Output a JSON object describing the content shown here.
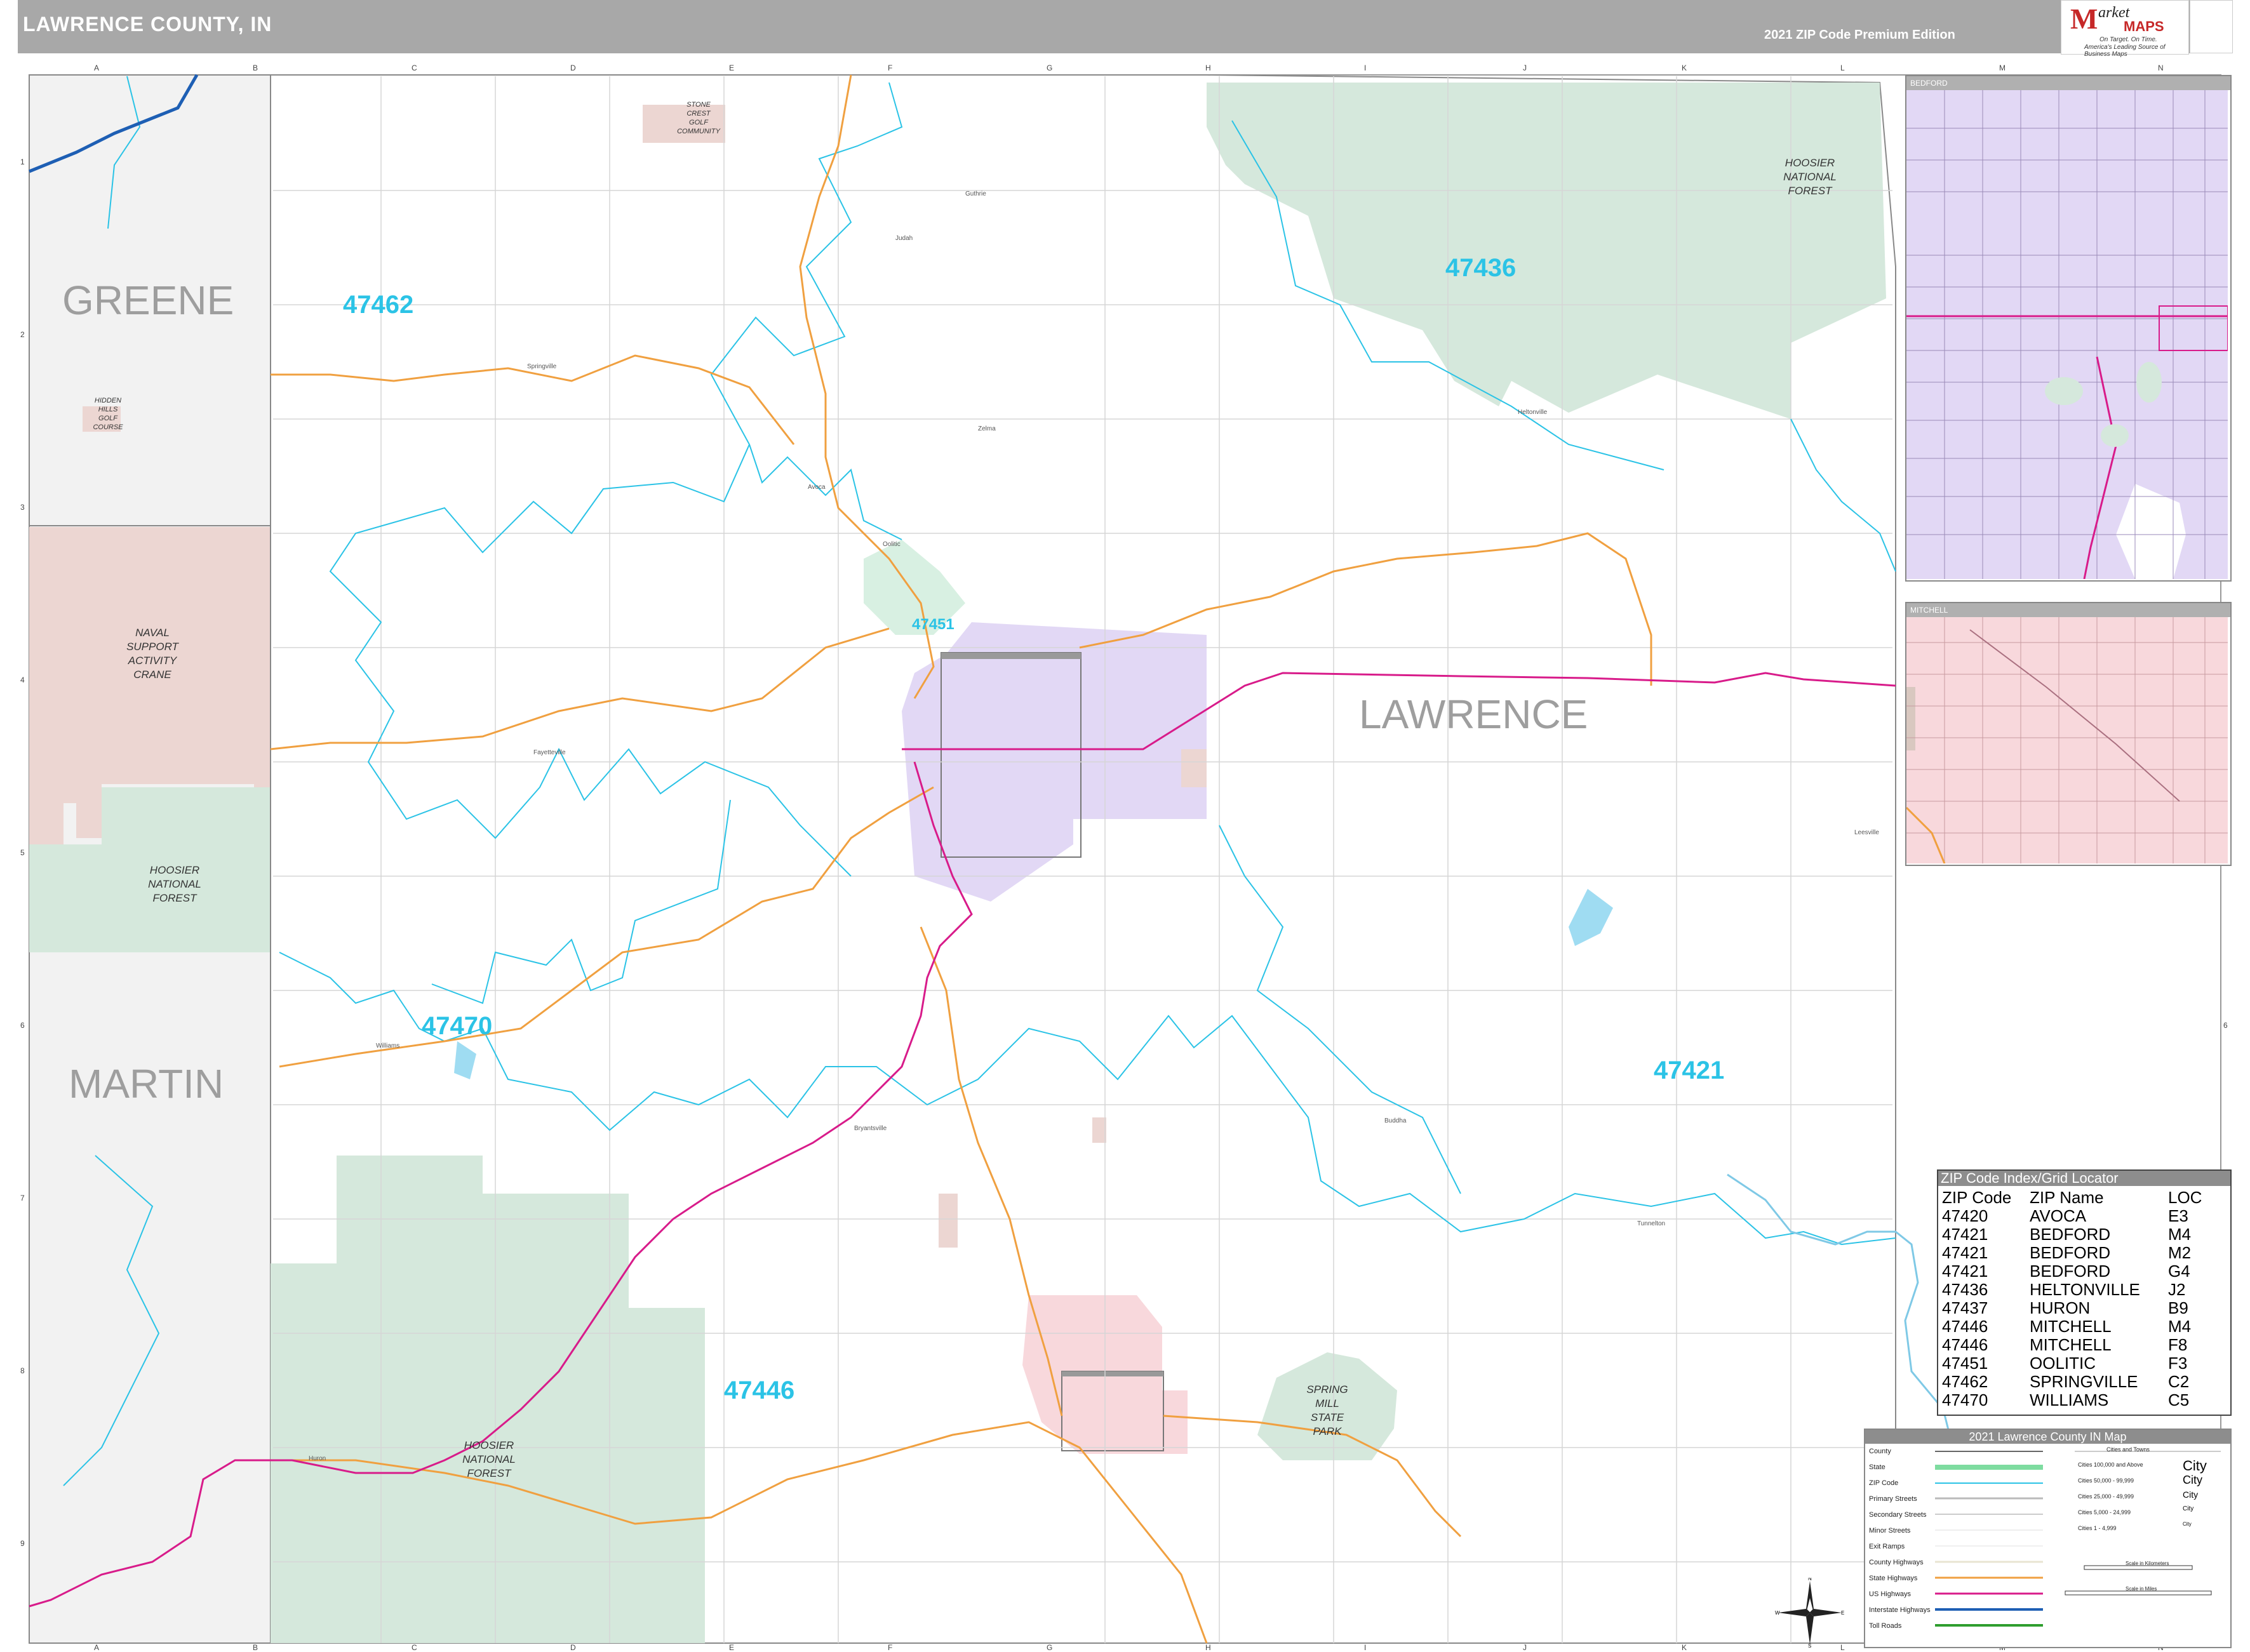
{
  "header": {
    "title": "LAWRENCE COUNTY, IN",
    "edition": "2021 ZIP Code Premium Edition"
  },
  "logo": {
    "m": "M",
    "arket": "arket",
    "maps": "MAPS",
    "tagline1": "On Target. On Time.",
    "tagline2": "America's Leading Source of Business Maps"
  },
  "grid": {
    "columns": [
      "A",
      "B",
      "C",
      "D",
      "E",
      "F",
      "G",
      "H",
      "I",
      "J",
      "K",
      "L",
      "M",
      "N"
    ],
    "rows": [
      "1",
      "2",
      "3",
      "4",
      "5",
      "6",
      "7",
      "8",
      "9"
    ]
  },
  "counties": {
    "greene": "GREENE",
    "martin": "MARTIN",
    "lawrence": "LAWRENCE"
  },
  "zip_labels": [
    "47462",
    "47436",
    "47451",
    "47470",
    "47421",
    "47446"
  ],
  "area_labels": {
    "stone_crest": [
      "STONE",
      "CREST",
      "GOLF",
      "COMMUNITY"
    ],
    "hoosier_ne": [
      "HOOSIER",
      "NATIONAL",
      "FOREST"
    ],
    "hidden_hills": [
      "HIDDEN",
      "HILLS",
      "GOLF",
      "COURSE"
    ],
    "naval": [
      "NAVAL",
      "SUPPORT",
      "ACTIVITY",
      "CRANE"
    ],
    "hoosier_w": [
      "HOOSIER",
      "NATIONAL",
      "FOREST"
    ],
    "spring_mill": [
      "SPRING",
      "MILL",
      "STATE",
      "PARK"
    ],
    "hoosier_sw": [
      "HOOSIER",
      "NATIONAL",
      "FOREST"
    ]
  },
  "places": [
    "Guthrie",
    "Judah",
    "Springville",
    "Buddha",
    "Williams",
    "Heltonville",
    "Huron",
    "Oolitic",
    "Avoca",
    "Fayetteville",
    "Tunnelton",
    "Leesville",
    "Bryantsville",
    "Zelma"
  ],
  "insets": {
    "bedford": "BEDFORD",
    "mitchell": "MITCHELL"
  },
  "zip_index": {
    "title": "ZIP Code Index/Grid Locator",
    "headers": [
      "ZIP Code",
      "ZIP Name",
      "LOC"
    ],
    "rows": [
      [
        "47420",
        "AVOCA",
        "E3"
      ],
      [
        "47421",
        "BEDFORD",
        "M4"
      ],
      [
        "47421",
        "BEDFORD",
        "M2"
      ],
      [
        "47421",
        "BEDFORD",
        "G4"
      ],
      [
        "47436",
        "HELTONVILLE",
        "J2"
      ],
      [
        "47437",
        "HURON",
        "B9"
      ],
      [
        "47446",
        "MITCHELL",
        "M4"
      ],
      [
        "47446",
        "MITCHELL",
        "F8"
      ],
      [
        "47451",
        "OOLITIC",
        "F3"
      ],
      [
        "47462",
        "SPRINGVILLE",
        "C2"
      ],
      [
        "47470",
        "WILLIAMS",
        "C5"
      ]
    ]
  },
  "legend": {
    "title": "2021 Lawrence County  IN Map",
    "items": [
      "County",
      "State",
      "ZIP Code",
      "Primary Streets",
      "Secondary Streets",
      "Minor Streets",
      "Exit Ramps",
      "County Highways",
      "State Highways",
      "US Highways",
      "Interstate Highways",
      "Toll Roads"
    ],
    "cities_title": "Cities and Towns",
    "city_tiers": [
      "Cities 100,000 and Above",
      "Cities 50,000 - 99,999",
      "Cities 25,000 - 49,999",
      "Cities 5,000 - 24,999",
      "Cities 1 - 4,999"
    ],
    "city_samples": [
      "City",
      "City",
      "City",
      "City",
      "City"
    ],
    "scale_km": "Scale in Kilometers",
    "scale_mi": "Scale in Miles",
    "colors": {
      "zip": "#2bc3e6",
      "state_hwy": "#f0a040",
      "us_hwy": "#d81b8a",
      "interstate": "#1e5fb4",
      "toll": "#2e9e2e",
      "forest": "#d5e8dc",
      "bedford": "#e2d8f5",
      "mitchell": "#f8d8dc",
      "naval": "#ecd6d2"
    }
  }
}
